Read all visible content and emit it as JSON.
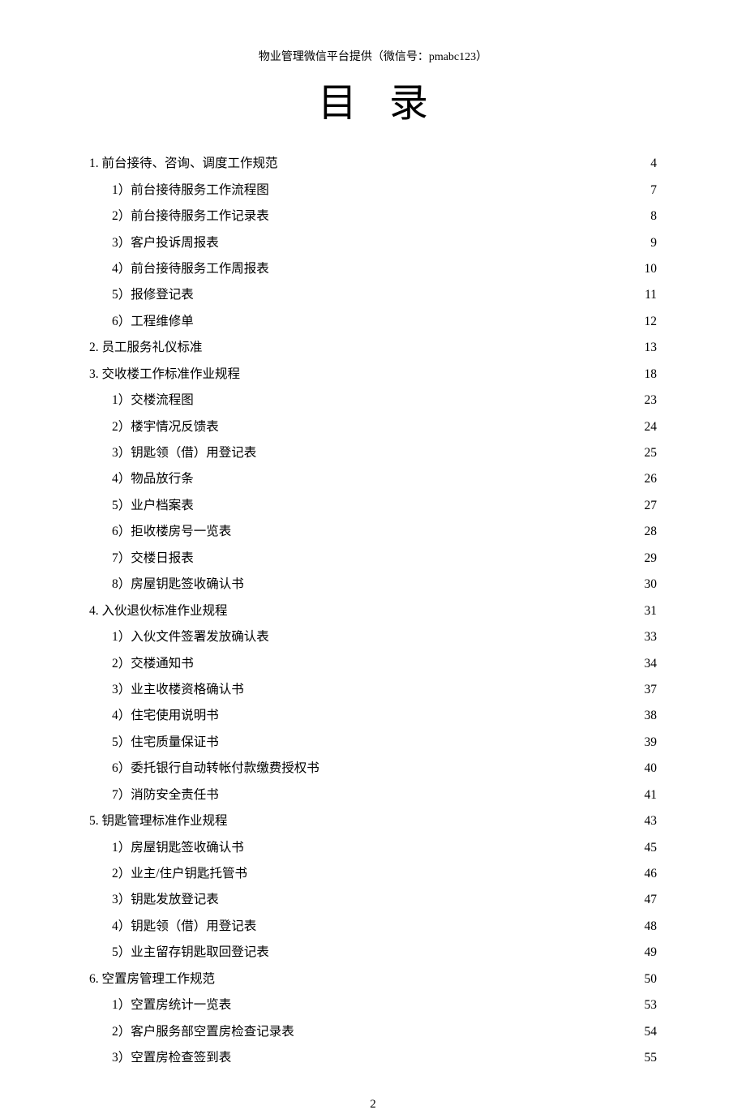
{
  "headerNote": "物业管理微信平台提供（微信号：pmabc123）",
  "title": "目录",
  "pageNumber": "2",
  "toc": [
    {
      "level": 0,
      "label": "1. 前台接待、咨询、调度工作规范 ",
      "page": " 4"
    },
    {
      "level": 1,
      "label": "1）前台接待服务工作流程图 ",
      "page": "7"
    },
    {
      "level": 1,
      "label": "2）前台接待服务工作记录表 ",
      "page": "8"
    },
    {
      "level": 1,
      "label": "3）客户投诉周报表 ",
      "page": "9"
    },
    {
      "level": 1,
      "label": "4）前台接待服务工作周报表 ",
      "page": "10"
    },
    {
      "level": 1,
      "label": "5）报修登记表 ",
      "page": "11"
    },
    {
      "level": 1,
      "label": "6）工程维修单 ",
      "page": "12"
    },
    {
      "level": 0,
      "label": "2. 员工服务礼仪标准",
      "page": "13"
    },
    {
      "level": 0,
      "label": "3. 交收楼工作标准作业规程",
      "page": "18"
    },
    {
      "level": 1,
      "label": "1）交楼流程图",
      "page": "23"
    },
    {
      "level": 1,
      "label": "2）楼宇情况反馈表",
      "page": "24"
    },
    {
      "level": 1,
      "label": "3）钥匙领（借）用登记表",
      "page": "25"
    },
    {
      "level": 1,
      "label": "4）物品放行条",
      "page": "26"
    },
    {
      "level": 1,
      "label": "5）业户档案表",
      "page": "27"
    },
    {
      "level": 1,
      "label": "6）拒收楼房号一览表",
      "page": "28"
    },
    {
      "level": 1,
      "label": "7）交楼日报表",
      "page": "29"
    },
    {
      "level": 1,
      "label": "8）房屋钥匙签收确认书",
      "page": "30"
    },
    {
      "level": 0,
      "label": "4. 入伙退伙标准作业规程",
      "page": "31"
    },
    {
      "level": 1,
      "label": "1）入伙文件签署发放确认表",
      "page": "33"
    },
    {
      "level": 1,
      "label": "2）交楼通知书",
      "page": "34"
    },
    {
      "level": 1,
      "label": "3）业主收楼资格确认书",
      "page": "37"
    },
    {
      "level": 1,
      "label": "4）住宅使用说明书",
      "page": "38"
    },
    {
      "level": 1,
      "label": "5）住宅质量保证书",
      "page": "39"
    },
    {
      "level": 1,
      "label": "6）委托银行自动转帐付款缴费授权书",
      "page": "40"
    },
    {
      "level": 1,
      "label": "7）消防安全责任书",
      "page": "41"
    },
    {
      "level": 0,
      "label": "5. 钥匙管理标准作业规程 ",
      "page": "43"
    },
    {
      "level": 1,
      "label": "1）房屋钥匙签收确认书",
      "page": "45"
    },
    {
      "level": 1,
      "label": "2）业主/住户钥匙托管书 ",
      "page": "46"
    },
    {
      "level": 1,
      "label": "3）钥匙发放登记表",
      "page": "47"
    },
    {
      "level": 1,
      "label": "4）钥匙领（借）用登记表",
      "page": "48"
    },
    {
      "level": 1,
      "label": "5）业主留存钥匙取回登记表",
      "page": "49"
    },
    {
      "level": 0,
      "label": "6. 空置房管理工作规范",
      "page": "50"
    },
    {
      "level": 1,
      "label": "1）空置房统计一览表",
      "page": "53"
    },
    {
      "level": 1,
      "label": "2）客户服务部空置房检查记录表",
      "page": "54"
    },
    {
      "level": 1,
      "label": "3）空置房检查签到表",
      "page": "55"
    }
  ]
}
